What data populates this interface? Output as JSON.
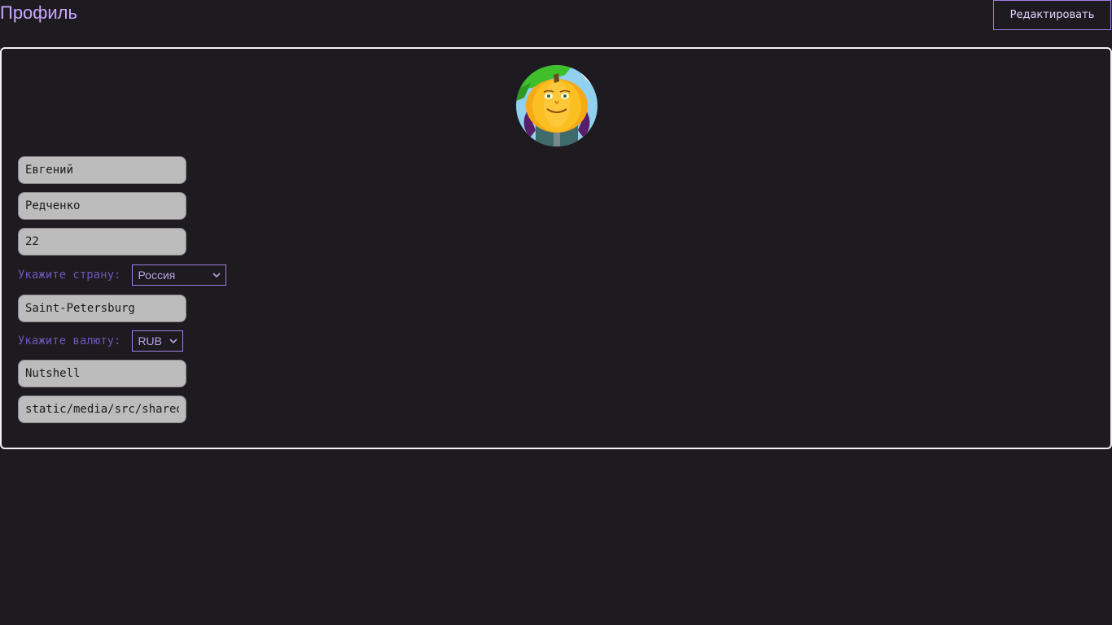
{
  "header": {
    "title": "Профиль",
    "edit_label": "Редактировать"
  },
  "profile": {
    "avatar_icon": "pumpkin-character-avatar",
    "first_name": "Евгений",
    "last_name": "Редченко",
    "age": "22",
    "country_label": "Укажите страну:",
    "country_value": "Россия",
    "city": "Saint-Petersburg",
    "currency_label": "Укажите валюту:",
    "currency_value": "RUB",
    "username": "Nutshell",
    "avatar_path": "static/media/src/shared/assets/avatar.jpg"
  },
  "colors": {
    "background": "#1d1b20",
    "accent": "#9d80e6",
    "title": "#c9a8ff",
    "label": "#6d56b8",
    "field_bg": "#bdbcbc",
    "card_border": "#f2f2f2"
  }
}
